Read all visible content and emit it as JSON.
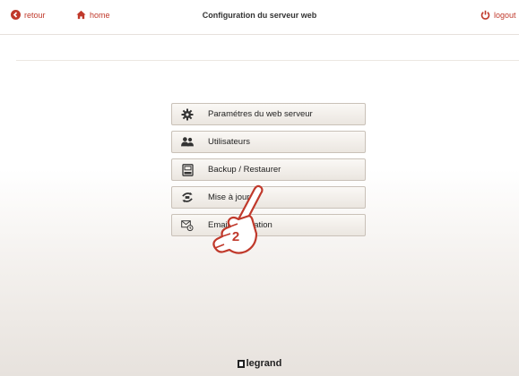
{
  "header": {
    "back_label": "retour",
    "home_label": "home",
    "title": "Configuration du serveur web",
    "logout_label": "logout"
  },
  "menu": {
    "items": [
      {
        "label": "Paramétres du web serveur",
        "icon": "gear-icon"
      },
      {
        "label": "Utilisateurs",
        "icon": "users-icon"
      },
      {
        "label": "Backup / Restaurer",
        "icon": "backup-icon"
      },
      {
        "label": "Mise à jour",
        "icon": "update-icon"
      },
      {
        "label": "Email notification",
        "icon": "email-notification-icon"
      }
    ]
  },
  "annotation": {
    "step": "2"
  },
  "footer": {
    "brand": "legrand"
  },
  "colors": {
    "accent": "#c0392b",
    "button_border": "#c9c1b8"
  }
}
